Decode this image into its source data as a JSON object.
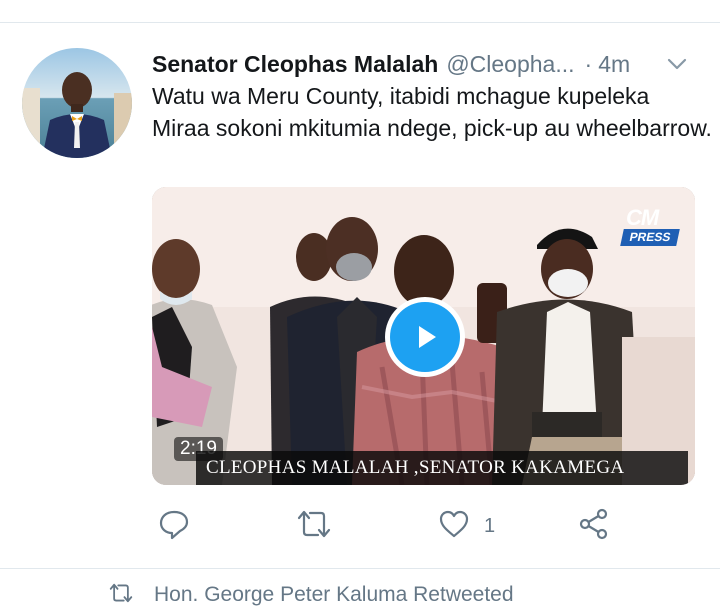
{
  "tweet": {
    "author": {
      "display_name": "Senator Cleophas Malalah",
      "handle": "@Cleopha...",
      "avatar": "avatar-photo"
    },
    "separator": "·",
    "timestamp": "4m",
    "text": "Watu wa Meru County, itabidi mchague kupeleka Miraa sokoni mkitumia ndege, pick-up au wheelbarrow.",
    "media": {
      "duration": "2:19",
      "caption": "CLEOPHAS MALALAH ,SENATOR KAKAMEGA",
      "logo_mark": "CM",
      "logo_label": "PRESS",
      "play_icon": "play-icon"
    },
    "actions": {
      "reply_icon": "reply-icon",
      "retweet_icon": "retweet-icon",
      "like_icon": "heart-icon",
      "like_count": "1",
      "share_icon": "share-icon"
    },
    "colors": {
      "accent": "#1da1f2",
      "muted": "#657786",
      "text": "#14171a",
      "divider": "#e1e8ed"
    }
  },
  "next_tweet": {
    "retweet_context": "Hon. George Peter Kaluma Retweeted"
  }
}
